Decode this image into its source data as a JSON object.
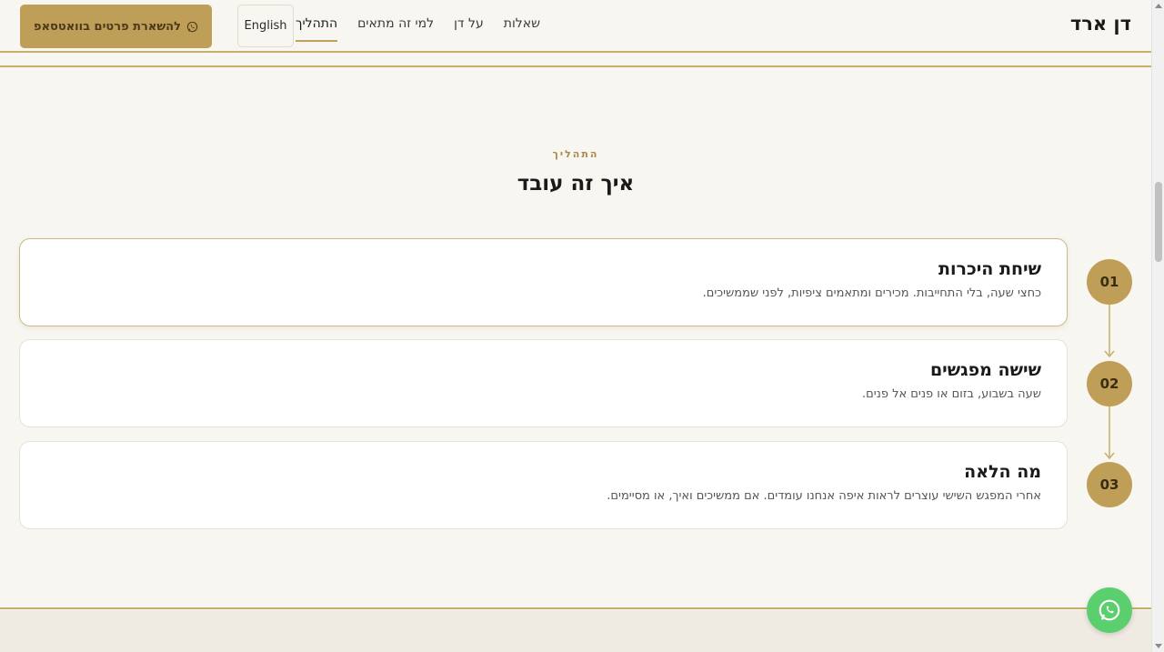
{
  "header": {
    "brand": "דן ארד",
    "nav": [
      {
        "label": "התהליך",
        "active": true
      },
      {
        "label": "למי זה מתאים",
        "active": false
      },
      {
        "label": "על דן",
        "active": false
      },
      {
        "label": "שאלות",
        "active": false
      }
    ],
    "language_button": "English",
    "whatsapp_cta": "להשארת פרטים בוואטסאפ",
    "whatsapp_icon": "whatsapp-icon"
  },
  "section": {
    "eyebrow": "התהליך",
    "title": "איך זה עובד"
  },
  "steps": [
    {
      "number": "01",
      "title": "שיחת היכרות",
      "description": "כחצי שעה, בלי התחייבות. מכירים ומתאמים ציפיות, לפני שממשיכים."
    },
    {
      "number": "02",
      "title": "שישה מפגשים",
      "description": "שעה בשבוע, בזום או פנים אל פנים."
    },
    {
      "number": "03",
      "title": "מה הלאה",
      "description": "אחרי המפגש השישי עוצרים לראות איפה אנחנו עומדים. אם ממשיכים ואיך, או מסיימים."
    }
  ],
  "colors": {
    "accent": "#bf9f58",
    "background": "#f8f6f1",
    "whatsapp": "#5bcf6e"
  }
}
